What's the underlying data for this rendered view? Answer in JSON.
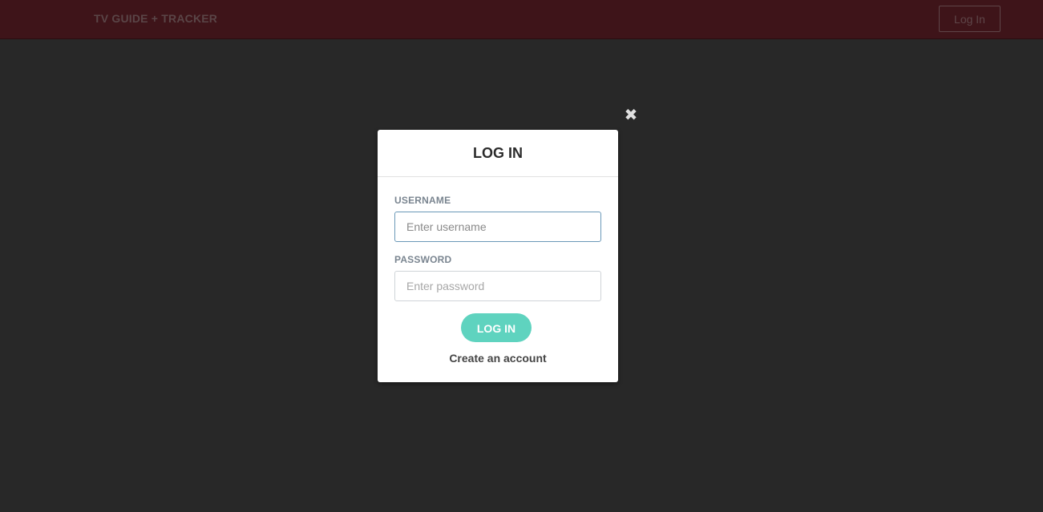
{
  "navbar": {
    "brand": "TV GUIDE + TRACKER",
    "login_label": "Log In"
  },
  "modal": {
    "title": "LOG IN",
    "close_icon": "close-icon",
    "username_label": "USERNAME",
    "username_placeholder": "Enter username",
    "username_value": "",
    "password_label": "PASSWORD",
    "password_placeholder": "Enter password",
    "password_value": "",
    "submit_label": "LOG IN",
    "create_account_label": "Create an account"
  },
  "colors": {
    "navbar_bg": "#3e1419",
    "overlay_bg": "#282828",
    "accent": "#5fd3bf"
  }
}
